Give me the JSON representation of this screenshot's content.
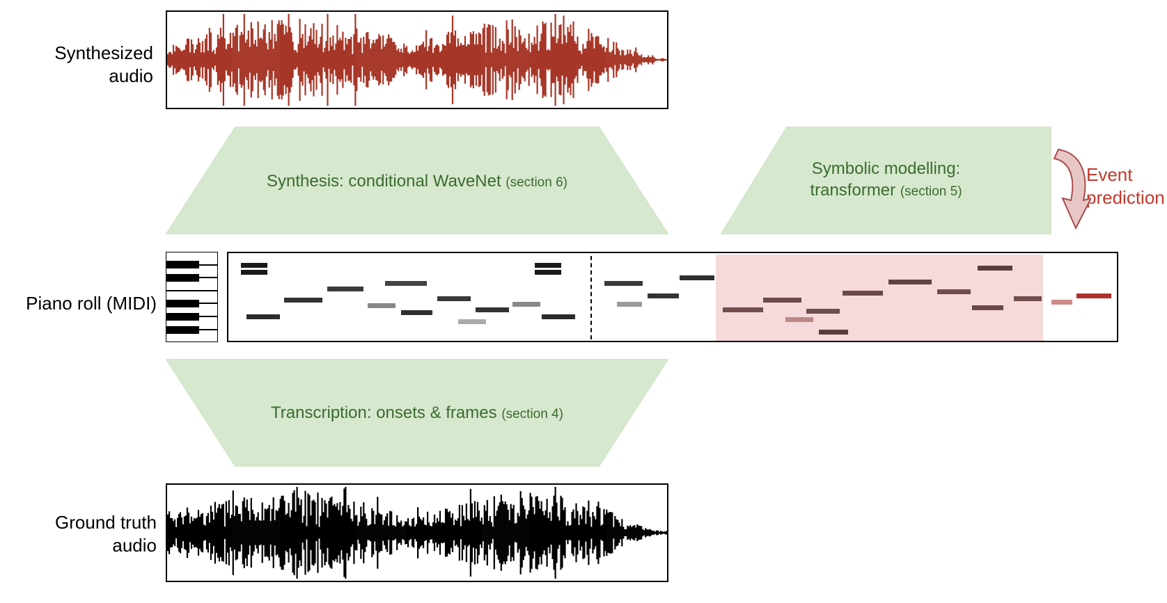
{
  "labels": {
    "synthesized_audio": "Synthesized\naudio",
    "piano_roll": "Piano roll (MIDI)",
    "ground_truth": "Ground truth\naudio",
    "event_prediction": "Event\nprediction"
  },
  "blocks": {
    "synthesis": {
      "main": "Synthesis: conditional WaveNet",
      "sec": "(section 6)"
    },
    "symbolic": {
      "main": "Symbolic modelling:",
      "main2": "transformer",
      "sec": "(section 5)"
    },
    "transcription": {
      "main": "Transcription: onsets & frames",
      "sec": "(section 4)"
    }
  },
  "colors": {
    "waveform_red": "#a63728",
    "waveform_black": "#000000",
    "trapezoid_fill": "#d6e8ce",
    "trapezoid_stroke": "#cfe2c6",
    "text_green": "#3a6b2f",
    "pink": "#f6d9da",
    "event_red": "#c0392b",
    "arrow_fill": "#e6c7c6",
    "arrow_stroke": "#a84b49"
  }
}
